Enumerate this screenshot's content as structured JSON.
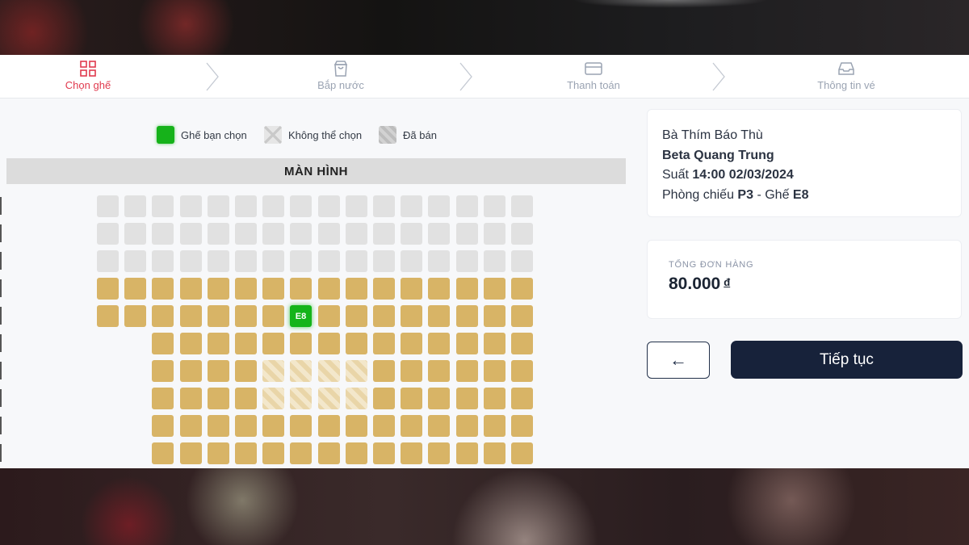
{
  "steps": [
    {
      "label": "Chọn ghế",
      "icon": "grid-icon",
      "active": true
    },
    {
      "label": "Bắp nước",
      "icon": "shopping-bag-icon",
      "active": false
    },
    {
      "label": "Thanh toán",
      "icon": "credit-card-icon",
      "active": false
    },
    {
      "label": "Thông tin vé",
      "icon": "inbox-icon",
      "active": false
    }
  ],
  "legend": {
    "selected": "Ghế bạn chọn",
    "unavailable": "Không thể chọn",
    "sold": "Đã bán"
  },
  "screen_label": "MÀN HÌNH",
  "seatmap": {
    "rows": [
      {
        "start": 0,
        "count": 16,
        "type": "vip"
      },
      {
        "start": 0,
        "count": 16,
        "type": "vip"
      },
      {
        "start": 0,
        "count": 16,
        "type": "vip"
      },
      {
        "start": 0,
        "count": 16,
        "type": "normal"
      },
      {
        "start": 0,
        "count": 16,
        "type": "normal"
      },
      {
        "start": 2,
        "count": 14,
        "type": "normal"
      },
      {
        "start": 2,
        "count": 14,
        "type": "normal"
      },
      {
        "start": 2,
        "count": 14,
        "type": "normal"
      },
      {
        "start": 2,
        "count": 14,
        "type": "normal"
      },
      {
        "start": 2,
        "count": 14,
        "type": "normal"
      }
    ],
    "selected": [
      {
        "row": 4,
        "col": 7,
        "label": "E8"
      }
    ],
    "sold": [
      {
        "row": 6,
        "col": 6
      },
      {
        "row": 6,
        "col": 7
      },
      {
        "row": 6,
        "col": 8
      },
      {
        "row": 6,
        "col": 9
      },
      {
        "row": 7,
        "col": 6
      },
      {
        "row": 7,
        "col": 7
      },
      {
        "row": 7,
        "col": 8
      },
      {
        "row": 7,
        "col": 9
      }
    ]
  },
  "booking": {
    "movie": "Bà Thím Báo Thù",
    "cinema": "Beta Quang Trung",
    "showtime_label": "Suất",
    "showtime": "14:00 02/03/2024",
    "room_label": "Phòng chiếu",
    "room": "P3",
    "seat_label": "- Ghế",
    "seat": "E8"
  },
  "order": {
    "total_label": "TỔNG ĐƠN HÀNG",
    "total": "80.000",
    "currency": "đ"
  },
  "buttons": {
    "back": "←",
    "next": "Tiếp tục"
  },
  "colors": {
    "accent": "#e03a4e",
    "seat_normal": "#d8b466",
    "seat_vip": "#e1e1e1",
    "seat_selected": "#14b41a",
    "button_primary": "#17223a"
  }
}
